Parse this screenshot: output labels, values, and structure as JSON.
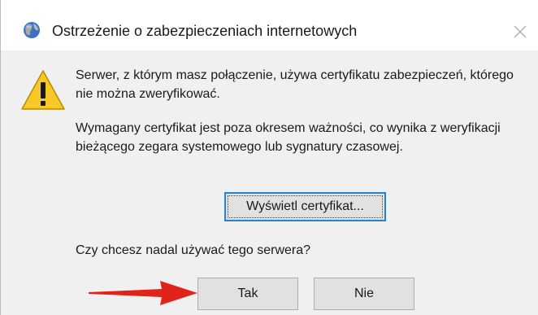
{
  "dialog": {
    "title": "Ostrzeżenie o zabezpieczeniach internetowych",
    "message1": "Serwer, z którym masz połączenie, używa certyfikatu zabezpieczeń, którego nie można zweryfikować.",
    "message2": "Wymagany certyfikat jest poza okresem ważności, co wynika z weryfikacji bieżącego zegara systemowego lub sygnatury czasowej.",
    "view_certificate_label": "Wyświetl certyfikat...",
    "question": "Czy chcesz nadal używać tego serwera?",
    "yes_label": "Tak",
    "no_label": "Nie"
  },
  "icons": {
    "title": "globe-icon",
    "warning": "warning-icon",
    "close": "close-icon",
    "annotation": "red-arrow-icon"
  },
  "colors": {
    "warning_yellow": "#f7c928",
    "arrow_red": "#e0241a",
    "focus_blue": "#1e84d6"
  }
}
